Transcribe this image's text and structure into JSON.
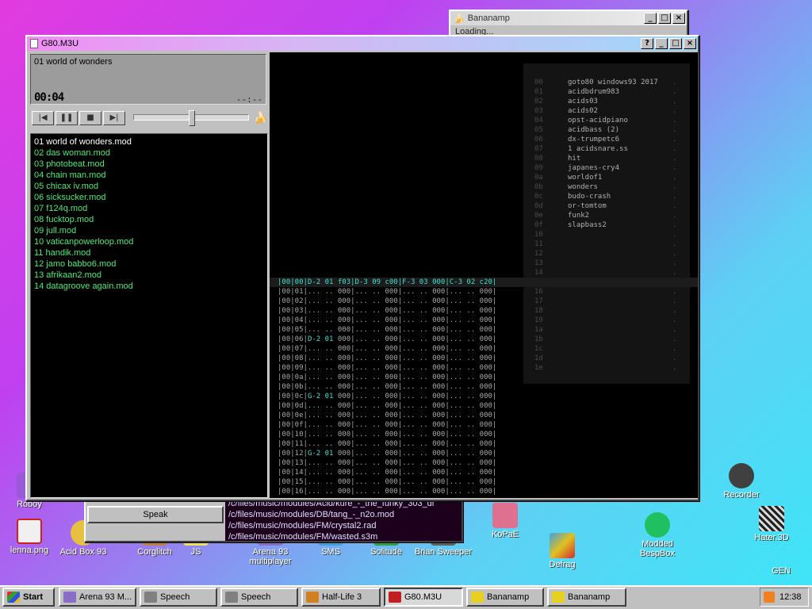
{
  "desktop_icons": [
    {
      "label": "Roboy"
    },
    {
      "label": "lenna.png"
    },
    {
      "label": "Acid Box 93"
    },
    {
      "label": "Corglitch"
    },
    {
      "label": "JS"
    },
    {
      "label": "Arena 93 multiplayer"
    },
    {
      "label": "SMS"
    },
    {
      "label": "Solitude"
    },
    {
      "label": "Brian Sweeper"
    },
    {
      "label": "Defrag"
    },
    {
      "label": "Modded BespBox"
    },
    {
      "label": "Recorder"
    },
    {
      "label": "KoPaE"
    },
    {
      "label": "Hater.3D"
    },
    {
      "label": "GEN"
    }
  ],
  "bananamp_bg": {
    "title": "Bananamp",
    "content": "Loading..."
  },
  "speech_window": {
    "button": "Speak",
    "lines": [
      "/c/files/music/modules/Acid/kure_-_the_funky_303_dr",
      "/c/files/music/modules/DB/tang_-_n2o.mod",
      "/c/files/music/modules/FM/crystal2.rad",
      "/c/files/music/modules/FM/wasted.s3m"
    ]
  },
  "player": {
    "title": "G80.M3U",
    "now_playing": "01 world of wonders",
    "elapsed": "00:04",
    "total": "--:--",
    "volume": 0.5,
    "controls": [
      "previous",
      "pause",
      "stop",
      "next"
    ],
    "playlist": [
      "01 world of wonders.mod",
      "02 das woman.mod",
      "03 photobeat.mod",
      "04 chain man.mod",
      "05 chicax iv.mod",
      "06 sicksucker.mod",
      "07 f124q.mod",
      "08 fucktop.mod",
      "09 jull.mod",
      "10 vaticanpowerloop.mod",
      "11 handik.mod",
      "12 jamo babbo6.mod",
      "13 afrikaan2.mod",
      "14 datagroove again.mod"
    ],
    "instruments": [
      {
        "num": "00",
        "name": "goto80 windows93 2017"
      },
      {
        "num": "01",
        "name": "acidbdrum983"
      },
      {
        "num": "02",
        "name": "acids03"
      },
      {
        "num": "03",
        "name": "acids02"
      },
      {
        "num": "04",
        "name": "opst-acidpiano"
      },
      {
        "num": "05",
        "name": "acidbass (2)"
      },
      {
        "num": "06",
        "name": "dx-trumpetc6"
      },
      {
        "num": "07",
        "name": "1 acidsnare.ss"
      },
      {
        "num": "08",
        "name": "hit"
      },
      {
        "num": "09",
        "name": "japanes-cry4"
      },
      {
        "num": "0a",
        "name": "worldof1"
      },
      {
        "num": "0b",
        "name": "wonders"
      },
      {
        "num": "0c",
        "name": "budo-crash"
      },
      {
        "num": "0d",
        "name": "or-tomtom"
      },
      {
        "num": "0e",
        "name": "funk2"
      },
      {
        "num": "0f",
        "name": "slapbass2"
      },
      {
        "num": "10",
        "name": ""
      },
      {
        "num": "11",
        "name": ""
      },
      {
        "num": "12",
        "name": ""
      },
      {
        "num": "13",
        "name": ""
      },
      {
        "num": "14",
        "name": ""
      },
      {
        "num": "15",
        "name": ""
      },
      {
        "num": "16",
        "name": ""
      },
      {
        "num": "17",
        "name": ""
      },
      {
        "num": "18",
        "name": ""
      },
      {
        "num": "19",
        "name": ""
      },
      {
        "num": "1a",
        "name": ""
      },
      {
        "num": "1b",
        "name": ""
      },
      {
        "num": "1c",
        "name": ""
      },
      {
        "num": "1d",
        "name": ""
      },
      {
        "num": "1e",
        "name": ""
      }
    ],
    "pattern_rows": [
      "|00|00|D-2 01 f03|D-3 09 c00|F-3 03 000|C-3 02 c20|",
      "|00|01|... .. 000|... .. 000|... .. 000|... .. 000|",
      "|00|02|... .. 000|... .. 000|... .. 000|... .. 000|",
      "|00|03|... .. 000|... .. 000|... .. 000|... .. 000|",
      "|00|04|... .. 000|... .. 000|... .. 000|... .. 000|",
      "|00|05|... .. 000|... .. 000|... .. 000|... .. 000|",
      "|00|06|D-2 01 000|... .. 000|... .. 000|... .. 000|",
      "|00|07|... .. 000|... .. 000|... .. 000|... .. 000|",
      "|00|08|... .. 000|... .. 000|... .. 000|... .. 000|",
      "|00|09|... .. 000|... .. 000|... .. 000|... .. 000|",
      "|00|0a|... .. 000|... .. 000|... .. 000|... .. 000|",
      "|00|0b|... .. 000|... .. 000|... .. 000|... .. 000|",
      "|00|0c|G-2 01 000|... .. 000|... .. 000|... .. 000|",
      "|00|0d|... .. 000|... .. 000|... .. 000|... .. 000|",
      "|00|0e|... .. 000|... .. 000|... .. 000|... .. 000|",
      "|00|0f|... .. 000|... .. 000|... .. 000|... .. 000|",
      "|00|10|... .. 000|... .. 000|... .. 000|... .. 000|",
      "|00|11|... .. 000|... .. 000|... .. 000|... .. 000|",
      "|00|12|G-2 01 000|... .. 000|... .. 000|... .. 000|",
      "|00|13|... .. 000|... .. 000|... .. 000|... .. 000|",
      "|00|14|... .. 000|... .. 000|... .. 000|... .. 000|",
      "|00|15|... .. 000|... .. 000|... .. 000|... .. 000|",
      "|00|16|... .. 000|... .. 000|... .. 000|... .. 000|"
    ]
  },
  "taskbar": {
    "start": "Start",
    "tasks": [
      {
        "label": "Arena 93 M...",
        "icon": "cube-icon",
        "color": "#8a6dc6"
      },
      {
        "label": "Speech",
        "icon": "speech-icon",
        "color": "#808080"
      },
      {
        "label": "Speech",
        "icon": "speech-icon",
        "color": "#808080"
      },
      {
        "label": "Half-Life 3",
        "icon": "half-life-icon",
        "color": "#d08020"
      },
      {
        "label": "G80.M3U",
        "icon": "music-icon",
        "color": "#c02020"
      },
      {
        "label": "Bananamp",
        "icon": "banana-icon",
        "color": "#e8d020"
      },
      {
        "label": "Bananamp",
        "icon": "banana-icon",
        "color": "#e8d020"
      }
    ],
    "clock": "12:38"
  },
  "colors": {
    "playlist_active": "#ffffff",
    "playlist_item": "#4de87a",
    "cyan_note": "#3fe0d0",
    "tracker_dim": "#9a9a9a"
  }
}
